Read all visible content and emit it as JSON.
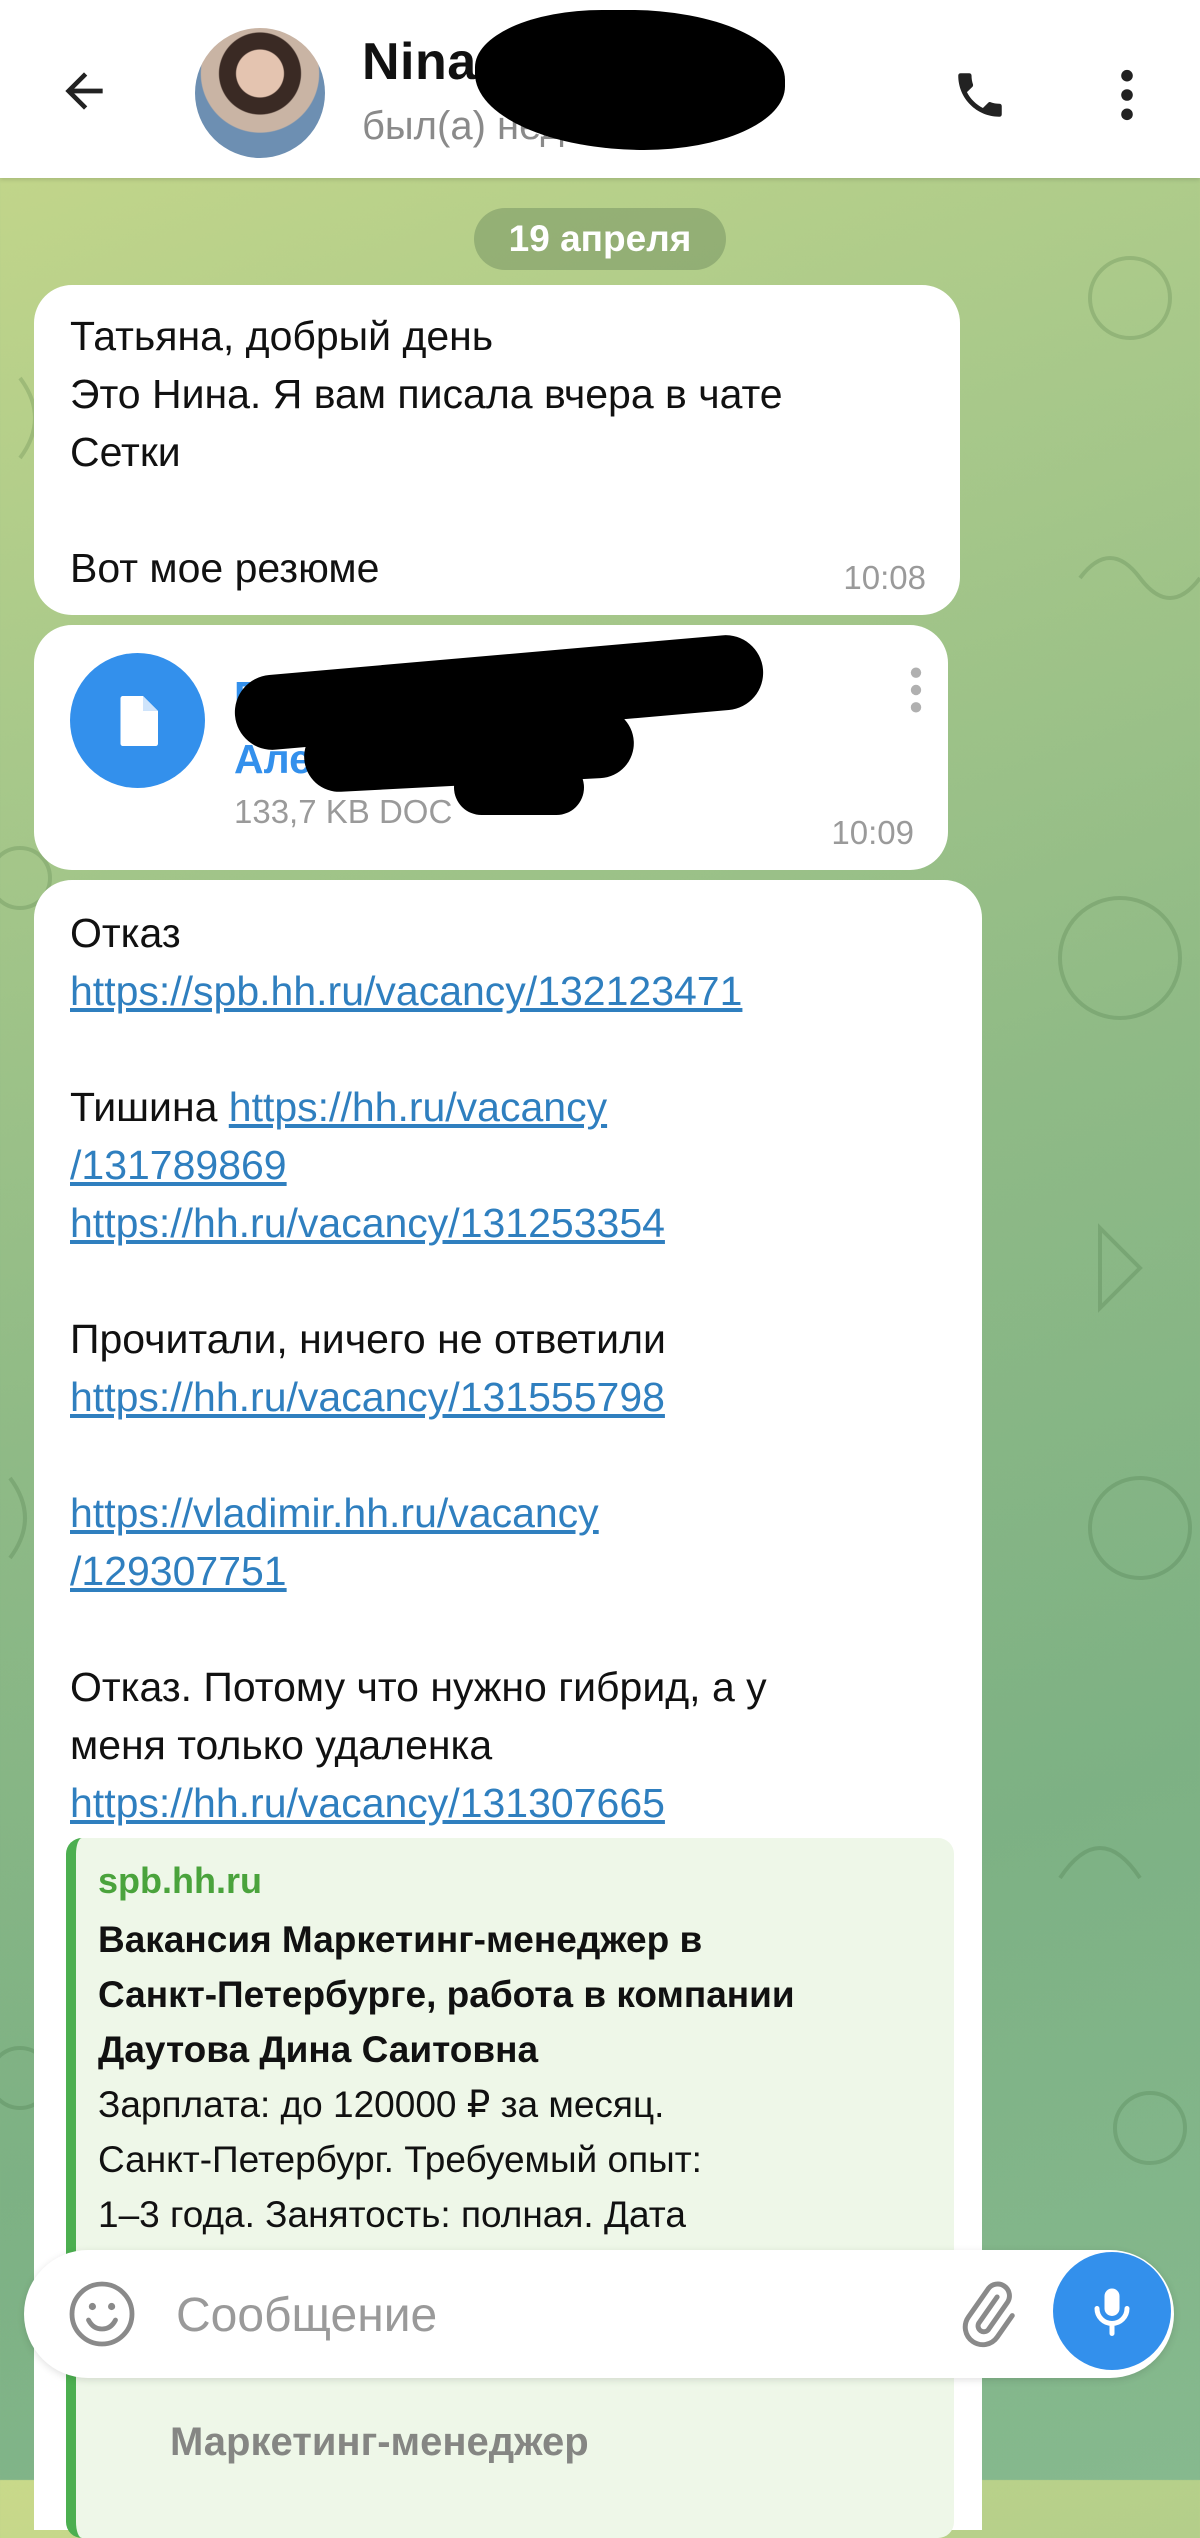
{
  "header": {
    "contact_name": "Nina Gris",
    "status": "был(а) недавно"
  },
  "chat": {
    "date_chip": "19 апреля",
    "message1": {
      "text": "Татьяна, добрый день\nЭто Нина. Я вам писала вчера в чате\nСетки\n\nВот мое резюме",
      "time": "10:08"
    },
    "file_message": {
      "file_name_line1": "Б",
      "file_name_line2": "Але                    на (3).doc",
      "meta": "133,7 KB DOC",
      "time": "10:09"
    },
    "message3": {
      "l1": "Отказ",
      "link1": "https://spb.hh.ru/vacancy/132123471",
      "l3_text": "Тишина ",
      "link2_part1": "https://hh.ru/vacancy",
      "link2_part2": "/131789869",
      "link3": "https://hh.ru/vacancy/131253354",
      "l6": "Прочитали, ничего не ответили",
      "link4": "https://hh.ru/vacancy/131555798",
      "link5_part1": "https://vladimir.hh.ru/vacancy",
      "link5_part2": "/129307751",
      "l9": "Отказ. Потому что нужно гибрид, а у",
      "l10": "меня только удаленка",
      "link6": "https://hh.ru/vacancy/131307665"
    },
    "link_preview": {
      "site": "spb.hh.ru",
      "title": "Вакансия Маркетинг-менеджер в\nСанкт-Петербурге, работа в компании\nДаутова Дина Саитовна",
      "description": "Зарплата: до 120000 ₽ за месяц.\nСанкт-Петербург. Требуемый опыт:\n1–3 года. Занятость: полная. Дата",
      "image_text": "Маркетинг-менеджер"
    }
  },
  "composer": {
    "placeholder": "Сообщение"
  },
  "colors": {
    "accent": "#3390ec",
    "link": "#2f7fbf",
    "preview_green": "#4caf50"
  },
  "icons": [
    "back-arrow-icon",
    "phone-icon",
    "more-vert-icon",
    "file-icon",
    "emoji-icon",
    "attach-icon",
    "mic-icon"
  ]
}
